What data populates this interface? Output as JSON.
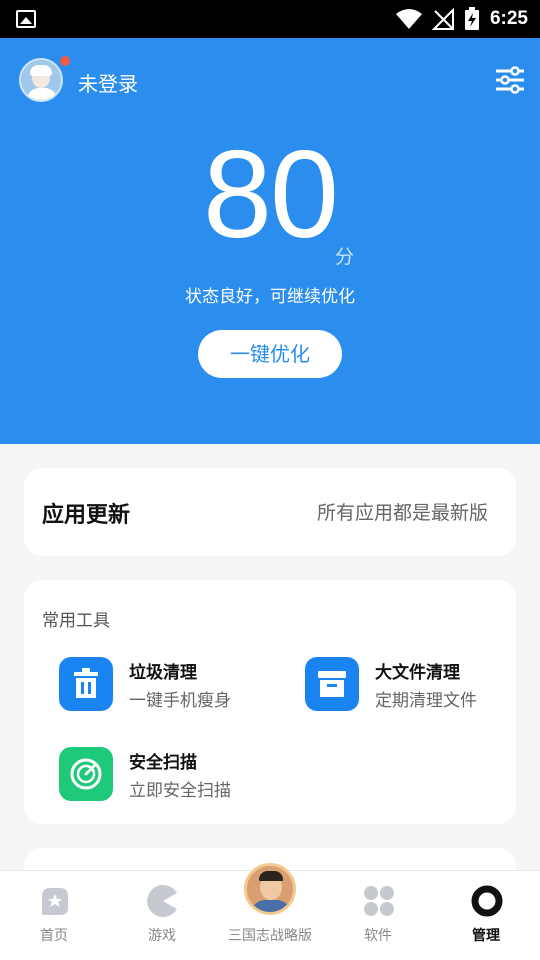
{
  "status_bar": {
    "time": "6:25"
  },
  "header": {
    "login_label": "未登录"
  },
  "score": {
    "value": "80",
    "unit": "分",
    "status_text": "状态良好，可继续优化",
    "optimize_button": "一键优化"
  },
  "update_card": {
    "title": "应用更新",
    "status": "所有应用都是最新版"
  },
  "tools": {
    "title": "常用工具",
    "items": [
      {
        "name": "垃圾清理",
        "desc": "一键手机瘦身",
        "icon": "trash-icon",
        "color": "#1a85f2"
      },
      {
        "name": "大文件清理",
        "desc": "定期清理文件",
        "icon": "archive-icon",
        "color": "#1a85f2"
      },
      {
        "name": "安全扫描",
        "desc": "立即安全扫描",
        "icon": "scan-icon",
        "color": "#1fc97a"
      }
    ]
  },
  "bottom_nav": {
    "items": [
      {
        "label": "首页",
        "icon": "home-star-icon"
      },
      {
        "label": "游戏",
        "icon": "pacman-icon"
      },
      {
        "label": "三国志战略版",
        "icon": "game-avatar-icon"
      },
      {
        "label": "软件",
        "icon": "apps-grid-icon"
      },
      {
        "label": "管理",
        "icon": "manage-ring-icon",
        "active": true
      }
    ]
  },
  "colors": {
    "primary": "#2b8eee",
    "background": "#f4f5f7",
    "badge": "#f15b45"
  }
}
